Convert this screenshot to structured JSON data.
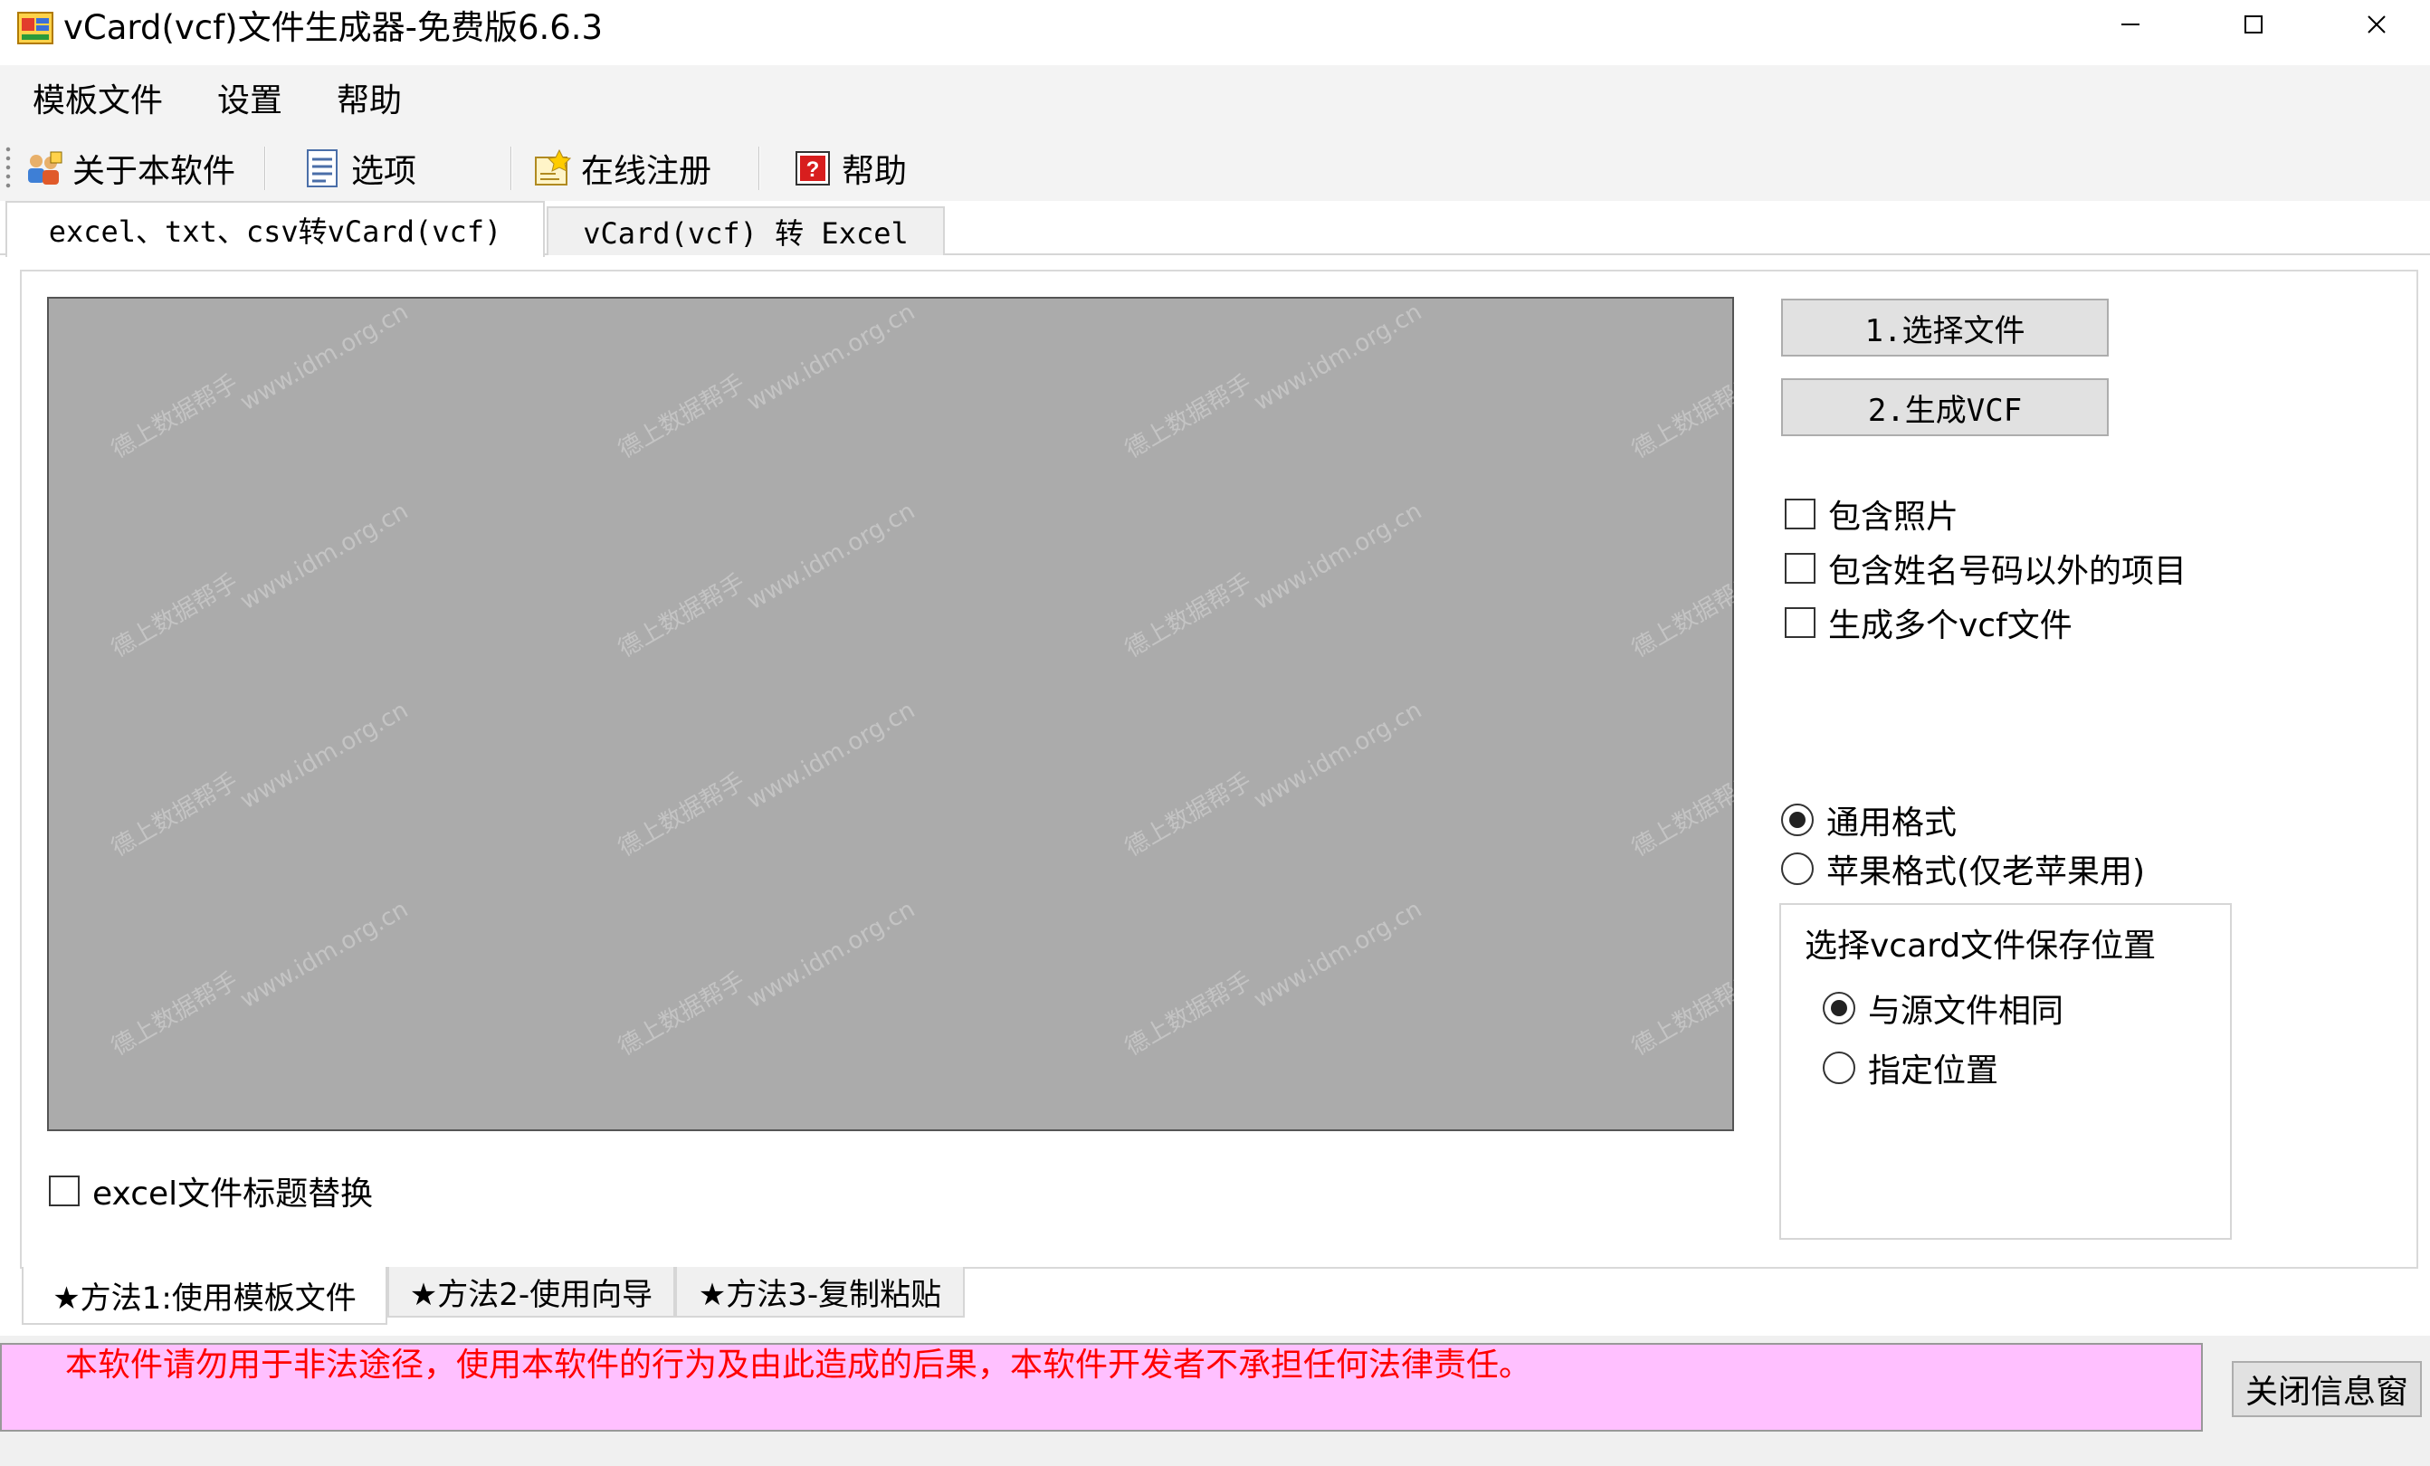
{
  "window": {
    "title": "vCard(vcf)文件生成器-免费版6.6.3",
    "minimize_icon": "minimize-icon",
    "maximize_icon": "maximize-icon",
    "close_icon": "close-icon"
  },
  "menu": {
    "items": [
      "模板文件",
      "设置",
      "帮助"
    ]
  },
  "toolbar": {
    "about_label": "关于本软件",
    "about_icon": "users-info-icon",
    "options_label": "选项",
    "options_icon": "document-list-icon",
    "register_label": "在线注册",
    "register_icon": "register-icon",
    "help_label": "帮助",
    "help_icon": "help-question-icon"
  },
  "top_tabs": [
    {
      "label": "excel、txt、csv转vCard(vcf)",
      "selected": true
    },
    {
      "label": "vCard(vcf) 转 Excel",
      "selected": false
    }
  ],
  "watermark": {
    "line1": "德上数据帮手",
    "line2": "www.idm.org.cn"
  },
  "actions": {
    "select_file_label": "1.选择文件",
    "generate_label": "2.生成VCF"
  },
  "options": {
    "include_photo": {
      "label": "包含照片",
      "checked": false
    },
    "include_other": {
      "label": "包含姓名号码以外的项目",
      "checked": false
    },
    "multi_files": {
      "label": "生成多个vcf文件",
      "checked": false
    },
    "excel_title_replace": {
      "label": "excel文件标题替换",
      "checked": false
    }
  },
  "format": {
    "general": {
      "label": "通用格式",
      "selected": true
    },
    "apple": {
      "label": "苹果格式(仅老苹果用)",
      "selected": false
    }
  },
  "save_location": {
    "title": "选择vcard文件保存位置",
    "same_as_source": {
      "label": "与源文件相同",
      "selected": true
    },
    "specified": {
      "label": "指定位置",
      "selected": false
    }
  },
  "method_tabs": [
    {
      "label": "★方法1:使用模板文件",
      "selected": true
    },
    {
      "label": "★方法2-使用向导",
      "selected": false
    },
    {
      "label": "★方法3-复制粘贴",
      "selected": false
    }
  ],
  "info": {
    "message": "本软件请勿用于非法途径，使用本软件的行为及由此造成的后果，本软件开发者不承担任何法律责任。",
    "close_label": "关闭信息窗"
  },
  "colors": {
    "grid_bg": "#ababab",
    "info_bg": "#ffc0ff",
    "info_text": "#ff0000"
  }
}
